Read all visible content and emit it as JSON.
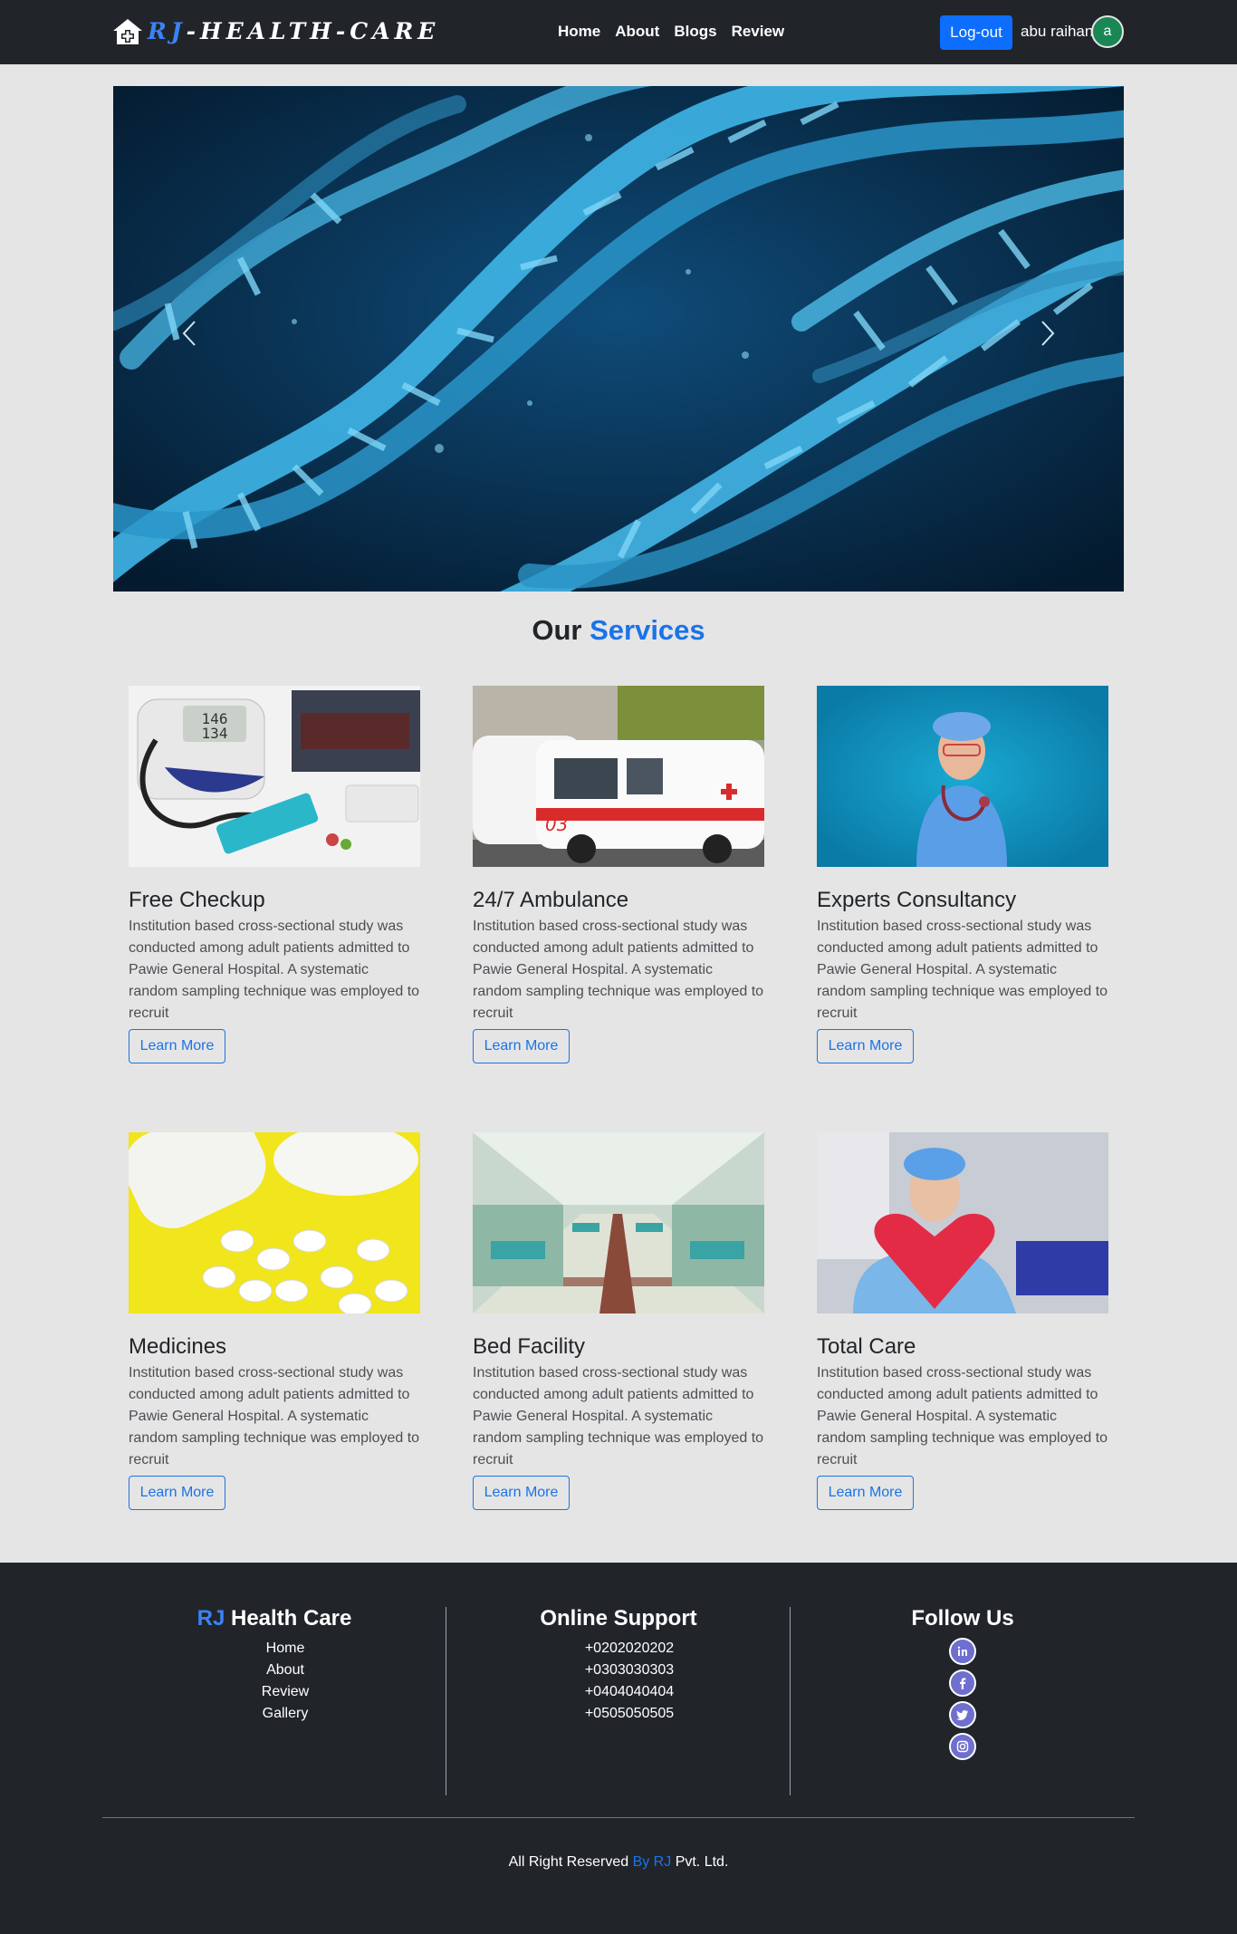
{
  "navbar": {
    "brand_prefix": "RJ",
    "brand_suffix": "-HEALTH-CARE",
    "links": [
      "Home",
      "About",
      "Blogs",
      "Review"
    ],
    "logout_label": "Log-out",
    "user_name": "abu raihan",
    "avatar_initial": "a"
  },
  "services": {
    "title_plain": "Our",
    "title_accent": "Services",
    "items": [
      {
        "title": "Free Checkup",
        "description": "Institution based cross-sectional study was conducted among adult patients admitted to Pawie General Hospital. A systematic random sampling technique was employed to recruit",
        "button": "Learn More"
      },
      {
        "title": "24/7 Ambulance",
        "description": "Institution based cross-sectional study was conducted among adult patients admitted to Pawie General Hospital. A systematic random sampling technique was employed to recruit",
        "button": "Learn More"
      },
      {
        "title": "Experts Consultancy",
        "description": "Institution based cross-sectional study was conducted among adult patients admitted to Pawie General Hospital. A systematic random sampling technique was employed to recruit",
        "button": "Learn More"
      },
      {
        "title": "Medicines",
        "description": "Institution based cross-sectional study was conducted among adult patients admitted to Pawie General Hospital. A systematic random sampling technique was employed to recruit",
        "button": "Learn More"
      },
      {
        "title": "Bed Facility",
        "description": "Institution based cross-sectional study was conducted among adult patients admitted to Pawie General Hospital. A systematic random sampling technique was employed to recruit",
        "button": "Learn More"
      },
      {
        "title": "Total Care",
        "description": "Institution based cross-sectional study was conducted among adult patients admitted to Pawie General Hospital. A systematic random sampling technique was employed to recruit",
        "button": "Learn More"
      }
    ]
  },
  "footer": {
    "col1": {
      "title_accent": "RJ",
      "title_plain": "Health Care",
      "links": [
        "Home",
        "About",
        "Review",
        "Gallery"
      ]
    },
    "col2": {
      "title": "Online Support",
      "phones": [
        "+0202020202",
        "+0303030303",
        "+0404040404",
        "+0505050505"
      ]
    },
    "col3": {
      "title": "Follow Us",
      "icons": [
        "linkedin-icon",
        "facebook-icon",
        "twitter-icon",
        "instagram-icon"
      ]
    },
    "copyright_prefix": "All Right Reserved",
    "copyright_accent": "By RJ",
    "copyright_suffix": "Pvt. Ltd."
  },
  "colors": {
    "navbar_bg": "#212529",
    "accent": "#1a73e8",
    "logout_bg": "#0d6efd",
    "page_bg": "#e5e5e5"
  }
}
